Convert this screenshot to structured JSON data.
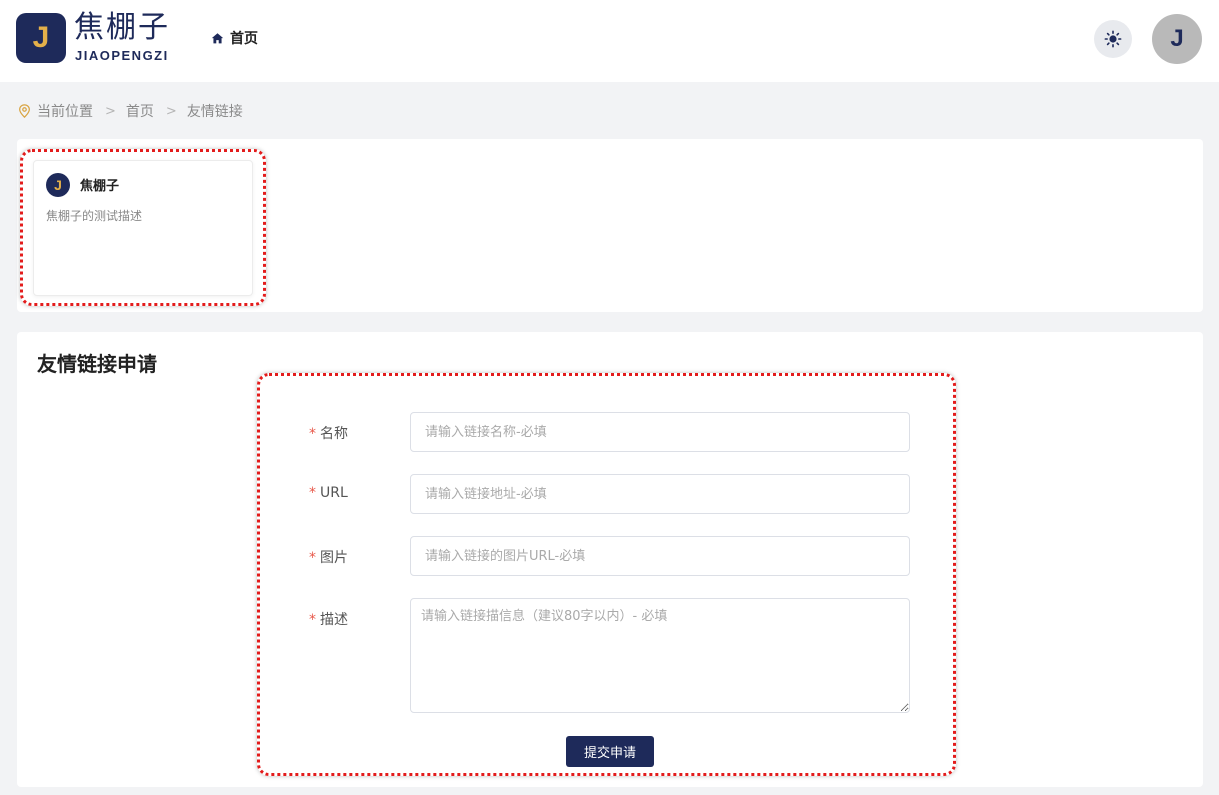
{
  "header": {
    "logo_letter": "J",
    "logo_cn": "焦棚子",
    "logo_en": "JIAOPENGZI",
    "nav_home_label": "首页",
    "home_icon": "home-icon",
    "theme_icon": "sun-icon",
    "avatar_letter": "J"
  },
  "breadcrumb": {
    "icon": "location-pin-icon",
    "items": [
      "当前位置",
      "首页",
      "友情链接"
    ],
    "separator": ">"
  },
  "links": [
    {
      "logo_letter": "J",
      "name": "焦棚子",
      "description": "焦棚子的测试描述"
    }
  ],
  "apply_form": {
    "title": "友情链接申请",
    "required_mark": "*",
    "fields": [
      {
        "label": "名称",
        "placeholder": "请输入链接名称-必填",
        "value": ""
      },
      {
        "label": "URL",
        "placeholder": "请输入链接地址-必填",
        "value": ""
      },
      {
        "label": "图片",
        "placeholder": "请输入链接的图片URL-必填",
        "value": ""
      },
      {
        "label": "描述",
        "placeholder": "请输入链接描信息（建议80字以内）- 必填",
        "value": ""
      }
    ],
    "submit_label": "提交申请"
  },
  "colors": {
    "brand_navy": "#1e2a5a",
    "brand_gold": "#e4b04a",
    "highlight_red": "#e31c1c",
    "required_red": "#e8584a",
    "page_bg": "#f2f3f5"
  }
}
